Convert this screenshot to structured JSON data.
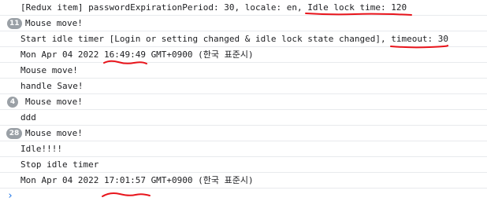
{
  "console": {
    "rows": [
      {
        "text": "[Redux item] passwordExpirationPeriod: 30, locale: en, Idle lock time: 120"
      },
      {
        "text": "Mouse move!",
        "count": "11"
      },
      {
        "text": "Start idle timer [Login or setting changed & idle lock state changed], timeout: 30"
      },
      {
        "text": "Mon Apr 04 2022 16:49:49 GMT+0900 (한국 표준시)"
      },
      {
        "text": "Mouse move!"
      },
      {
        "text": "handle Save!"
      },
      {
        "text": "Mouse move!",
        "count": "4"
      },
      {
        "text": "ddd"
      },
      {
        "text": "Mouse move!",
        "count": "28"
      },
      {
        "text": "Idle!!!!"
      },
      {
        "text": "Stop idle timer"
      },
      {
        "text": "Mon Apr 04 2022 17:01:57 GMT+0900 (한국 표준시)"
      }
    ],
    "prompt_icon": "chevron-right-icon",
    "annotation_color": "#e8141b"
  }
}
